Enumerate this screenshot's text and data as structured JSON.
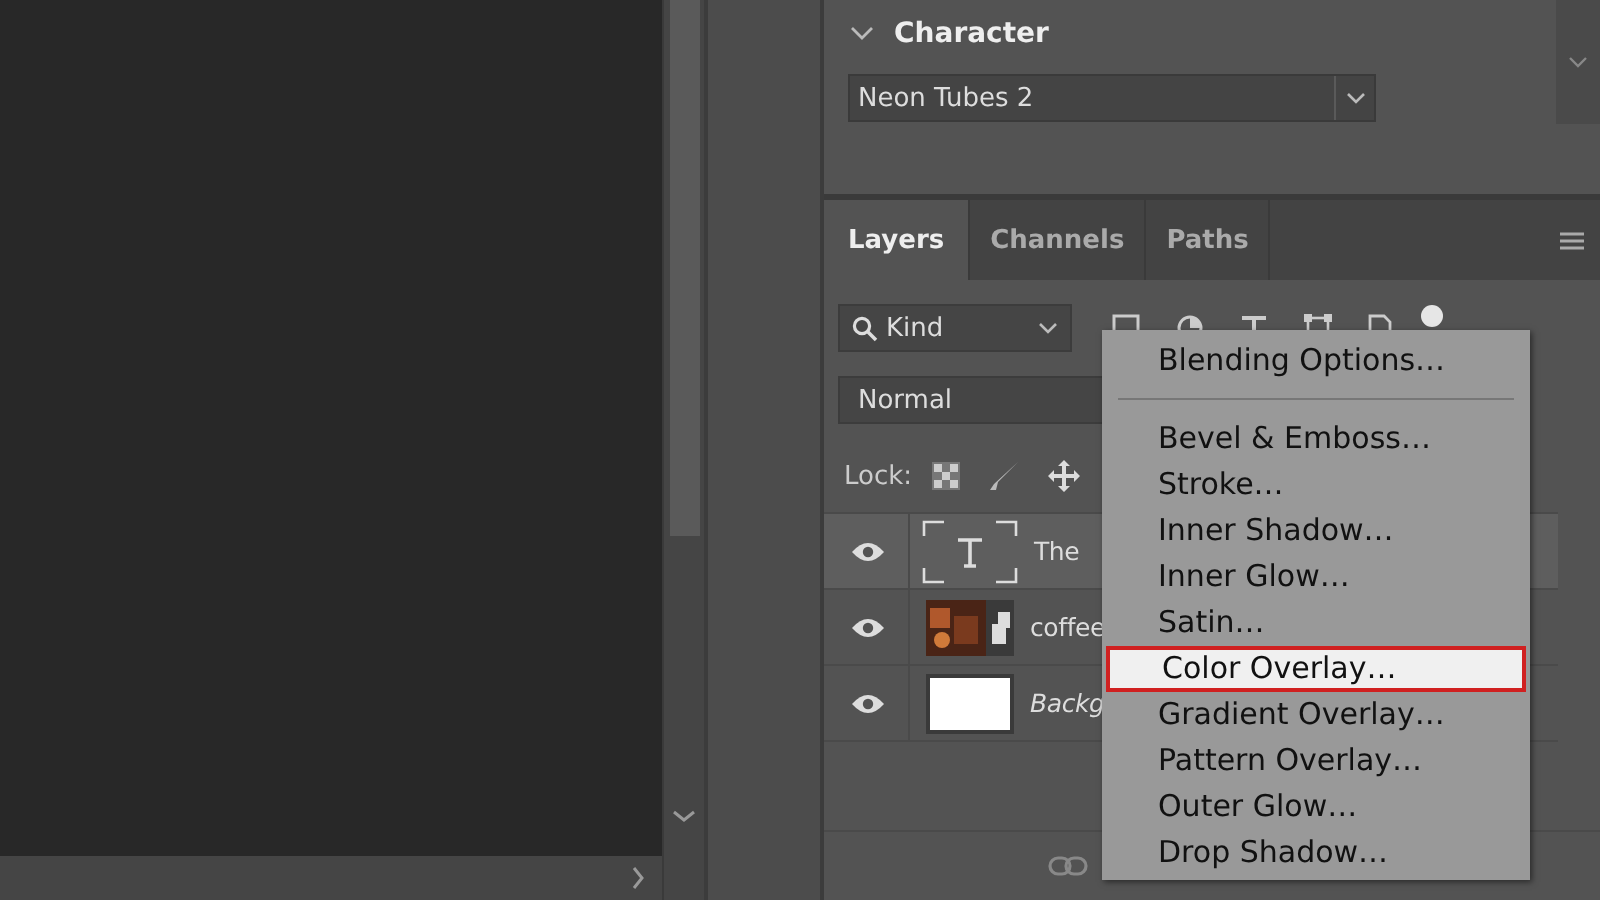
{
  "character": {
    "title": "Character",
    "expanded": true,
    "font": "Neon Tubes 2"
  },
  "tabs": [
    {
      "label": "Layers",
      "selected": true
    },
    {
      "label": "Channels",
      "selected": false
    },
    {
      "label": "Paths",
      "selected": false
    }
  ],
  "filter": {
    "value": "Kind"
  },
  "blend_mode": {
    "value": "Normal"
  },
  "lock": {
    "label": "Lock:"
  },
  "layers": [
    {
      "kind": "text",
      "name": "The",
      "visible": true,
      "selected": true,
      "italic": false
    },
    {
      "kind": "smart",
      "name": "coffee",
      "visible": true,
      "selected": false,
      "italic": false
    },
    {
      "kind": "fill",
      "name": "Backg",
      "visible": true,
      "selected": false,
      "italic": true
    }
  ],
  "context_menu": [
    {
      "label": "Blending Options…",
      "selected": false,
      "separator_after": true
    },
    {
      "label": "Bevel & Emboss…",
      "selected": false,
      "separator_after": false
    },
    {
      "label": "Stroke…",
      "selected": false,
      "separator_after": false
    },
    {
      "label": "Inner Shadow…",
      "selected": false,
      "separator_after": false
    },
    {
      "label": "Inner Glow…",
      "selected": false,
      "separator_after": false
    },
    {
      "label": "Satin…",
      "selected": false,
      "separator_after": false
    },
    {
      "label": "Color Overlay…",
      "selected": true,
      "separator_after": false
    },
    {
      "label": "Gradient Overlay…",
      "selected": false,
      "separator_after": false
    },
    {
      "label": "Pattern Overlay…",
      "selected": false,
      "separator_after": false
    },
    {
      "label": "Outer Glow…",
      "selected": false,
      "separator_after": false
    },
    {
      "label": "Drop Shadow…",
      "selected": false,
      "separator_after": false
    }
  ]
}
